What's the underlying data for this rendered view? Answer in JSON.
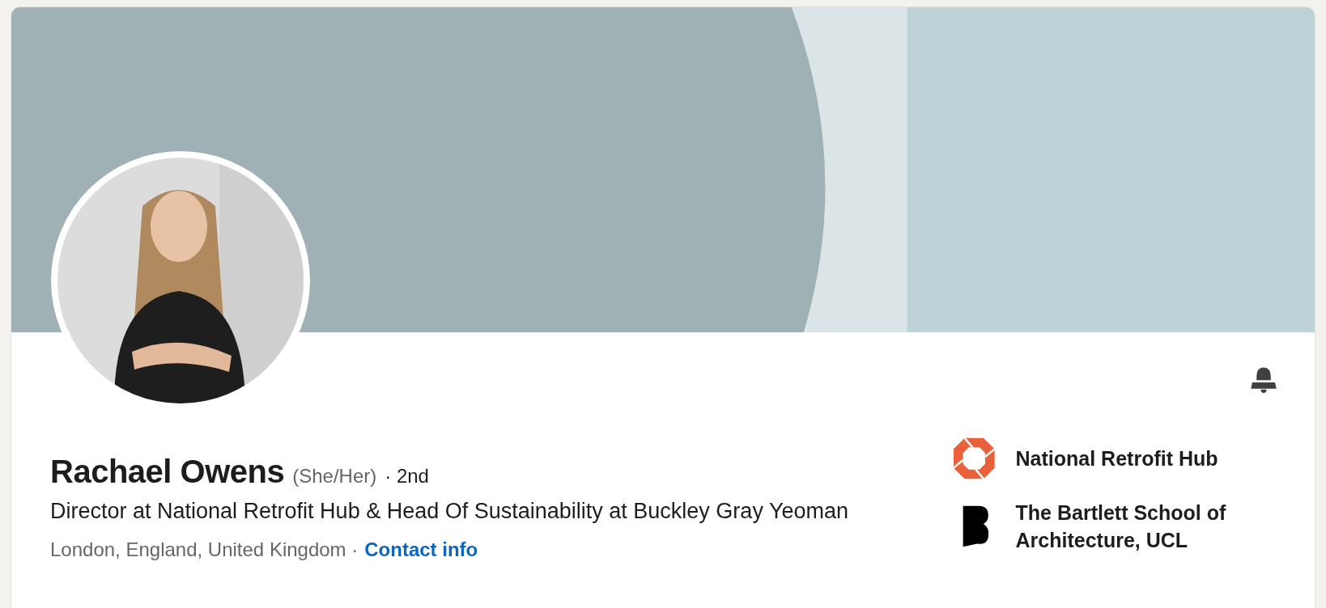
{
  "profile": {
    "name": "Rachael Owens",
    "pronouns": "(She/Her)",
    "degree": "· 2nd",
    "headline": "Director at National Retrofit Hub & Head Of Sustainability at Buckley Gray Yeoman",
    "location": "London, England, United Kingdom ·",
    "contact_link": "Contact info"
  },
  "affiliations": [
    {
      "kind": "company",
      "name": "National Retrofit Hub"
    },
    {
      "kind": "school",
      "name": "The Bartlett School of Architecture, UCL"
    }
  ]
}
